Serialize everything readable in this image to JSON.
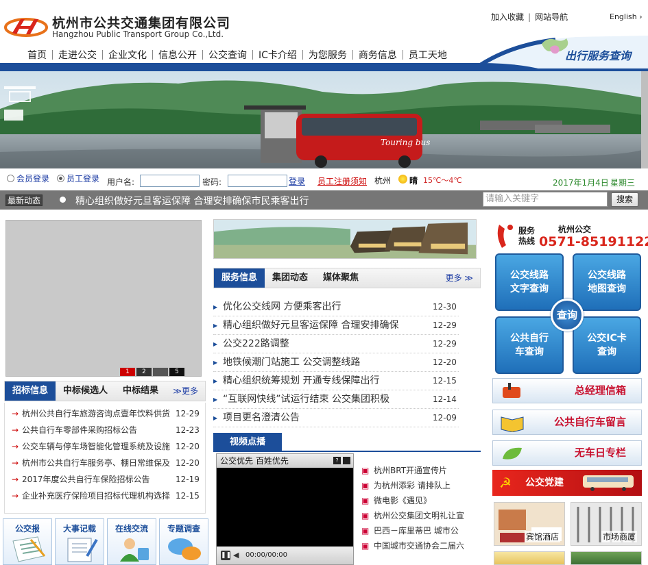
{
  "header": {
    "company_cn": "杭州市公共交通集团有限公司",
    "company_en": "Hangzhou Public Transport Group Co.,Ltd.",
    "top_links": [
      "加入收藏",
      "网站导航"
    ],
    "english": "English",
    "service_query": "出行服务查询"
  },
  "nav": [
    "首页",
    "走进公交",
    "企业文化",
    "信息公开",
    "公交查询",
    "IC卡介绍",
    "为您服务",
    "商务信息",
    "员工天地"
  ],
  "banner": {
    "bus_text": "Touring bus"
  },
  "login": {
    "member_login": "会员登录",
    "staff_login": "员工登录",
    "username_label": "用户名:",
    "password_label": "密码:",
    "login_button": "登录",
    "register_notice": "员工注册须知",
    "city": "杭州",
    "weather": "晴",
    "temperature": "15℃～4℃",
    "date": "2017年1月4日",
    "weekday": "星期三"
  },
  "news_strip": {
    "label": "最新动态",
    "headline": "精心组织做好元旦客运保障 合理安排确保市民乘客出行",
    "search_placeholder": "请输入关键字",
    "search_button": "搜索"
  },
  "slideshow": {
    "pager": [
      "1",
      "2",
      "5"
    ]
  },
  "bid": {
    "tabs": [
      "招标信息",
      "中标候选人",
      "中标结果"
    ],
    "more": "≫更多",
    "items": [
      {
        "title": "杭州公共自行车旅游咨询点壹年饮料供货",
        "date": "12-29"
      },
      {
        "title": "公共自行车零部件采购招标公告",
        "date": "12-23"
      },
      {
        "title": "公交车辆与停车场智能化管理系统及设施",
        "date": "12-20"
      },
      {
        "title": "杭州市公共自行车服务亭、棚日常维保及",
        "date": "12-20"
      },
      {
        "title": "2017年度公共自行车保险招标公告",
        "date": "12-19"
      },
      {
        "title": "企业补充医疗保险项目招标代理机构选择",
        "date": "12-15"
      }
    ]
  },
  "tiles": [
    "公交报",
    "大事记载",
    "在线交流",
    "专题调查"
  ],
  "service": {
    "tabs": [
      "服务信息",
      "集团动态",
      "媒体聚焦"
    ],
    "more": "更多 ≫",
    "items": [
      {
        "title": "优化公交线网 方便乘客出行",
        "date": "12-30"
      },
      {
        "title": "精心组织做好元旦客运保障 合理安排确保",
        "date": "12-29"
      },
      {
        "title": "公交222路调整",
        "date": "12-29"
      },
      {
        "title": "地铁候潮门站施工 公交调整线路",
        "date": "12-20"
      },
      {
        "title": "精心组织统筹规划 开通专线保障出行",
        "date": "12-15"
      },
      {
        "title": "“互联网快线”试运行结束 公交集团积极",
        "date": "12-14"
      },
      {
        "title": "项目更名澄清公告",
        "date": "12-09"
      }
    ]
  },
  "video": {
    "tab": "视频点播",
    "player_title": "公交优先 百姓优先",
    "time": "00:00/00:00",
    "items": [
      "杭州BRT开通宣传片",
      "为杭州添彩 请排队上",
      "微电影《遇见》",
      "杭州公交集团文明礼让宣",
      "巴西－库里蒂巴 城市公",
      "中国城市交通协会二届六"
    ]
  },
  "right": {
    "hotline_label": [
      "服务",
      "热线"
    ],
    "hotline_org": "杭州公交",
    "hotline_number": "0571-85191122",
    "query": [
      "公交线路\n文字查询",
      "公交线路\n地图查询",
      "公共自行\n车查询",
      "公交IC卡\n查询"
    ],
    "query_center": "查询",
    "buttons": [
      "总经理信箱",
      "公共自行车留言",
      "无车日专栏"
    ],
    "party": "公交党建",
    "photos": [
      "宾馆酒店",
      "市场商厦"
    ]
  }
}
